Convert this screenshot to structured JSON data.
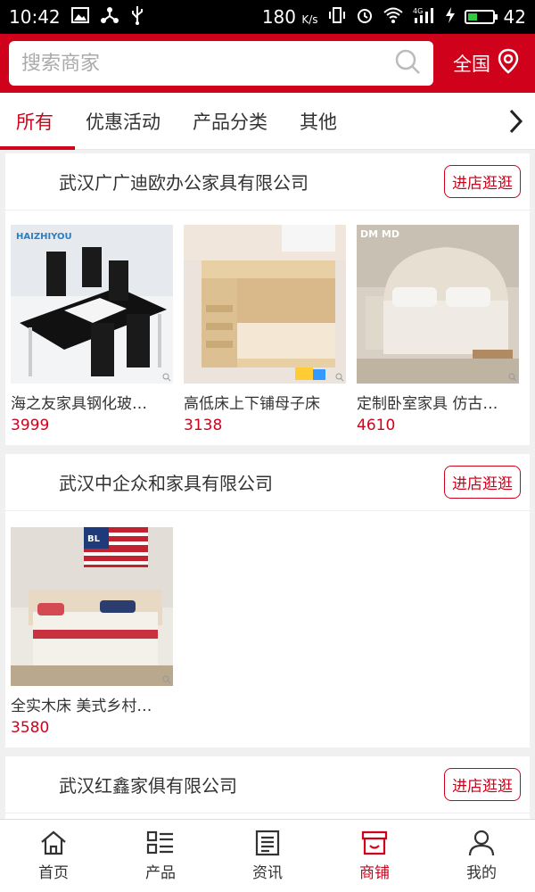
{
  "status_bar": {
    "time": "10:42",
    "speed": "180",
    "speed_unit": "K/s",
    "network": "4G",
    "battery": "42",
    "battery_level": 0.42
  },
  "search": {
    "placeholder": "搜索商家",
    "region_label": "全国"
  },
  "tabs": [
    {
      "label": "所有"
    },
    {
      "label": "优惠活动"
    },
    {
      "label": "产品分类"
    },
    {
      "label": "其他"
    }
  ],
  "stores": [
    {
      "name": "武汉广广迪欧办公家具有限公司",
      "visit_label": "进店逛逛",
      "products": [
        {
          "title": "海之友家具钢化玻…",
          "price": "3999",
          "brand_text": "HAIZHIYOU"
        },
        {
          "title": "高低床上下铺母子床",
          "price": "3138"
        },
        {
          "title": "定制卧室家具 仿古…",
          "price": "4610",
          "brand_text": "DM MD"
        }
      ]
    },
    {
      "name": "武汉中企众和家具有限公司",
      "visit_label": "进店逛逛",
      "products": [
        {
          "title": "全实木床 美式乡村…",
          "price": "3580",
          "brand_text": "BL"
        }
      ]
    },
    {
      "name": "武汉红鑫家俱有限公司",
      "visit_label": "进店逛逛",
      "products": []
    }
  ],
  "bottom_nav": [
    {
      "label": "首页",
      "icon": "home-icon"
    },
    {
      "label": "产品",
      "icon": "list-icon"
    },
    {
      "label": "资讯",
      "icon": "news-icon"
    },
    {
      "label": "商铺",
      "icon": "shop-icon"
    },
    {
      "label": "我的",
      "icon": "user-icon"
    }
  ],
  "colors": {
    "brand_red": "#d0021b"
  }
}
